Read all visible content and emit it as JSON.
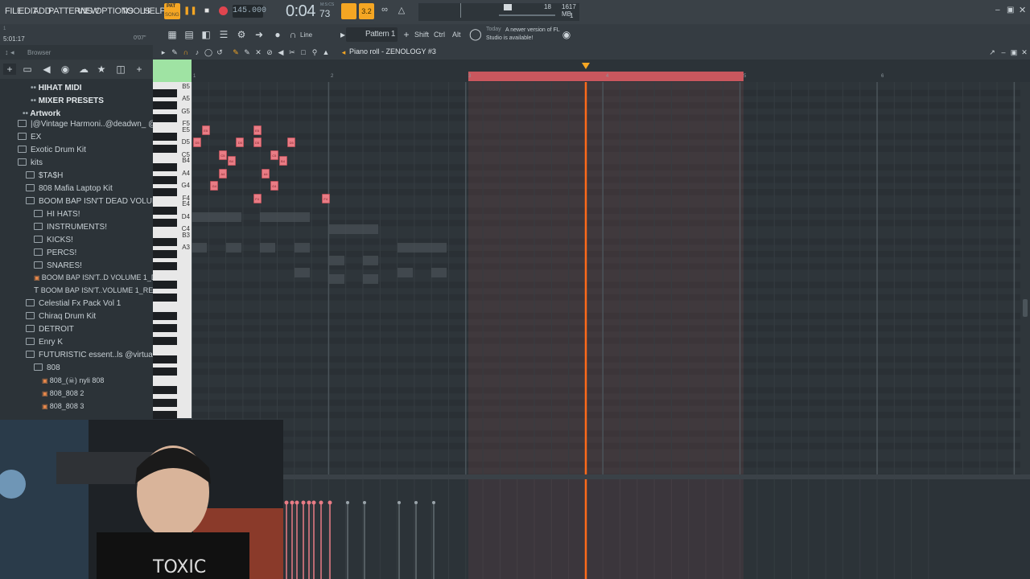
{
  "menu": [
    "FILE",
    "EDIT",
    "ADD",
    "PATTERNS",
    "VIEW",
    "OPTIONS",
    "TOOLS",
    "HELP"
  ],
  "transport": {
    "pat_label": "PAT",
    "song_label": "SONG",
    "tempo": "145.000",
    "time": "0:04",
    "time_small": "73",
    "time_unit": "M:S:CS",
    "cpu": "18",
    "memory": "1617 MB",
    "poly": "1"
  },
  "hint": {
    "time": "5:01:17",
    "value": "0'07\""
  },
  "toolbar": {
    "line_label": "Line",
    "pattern_label": "Pattern 1",
    "shift_label": "Shift",
    "ctrl_label": "Ctrl",
    "alt_label": "Alt",
    "news_day": "Today",
    "news_text": "A newer version of FL Studio is available!"
  },
  "browser": {
    "title": "Browser",
    "items": [
      {
        "label": "HIHAT MIDI",
        "indent": 38,
        "bold": true,
        "kind": "dots"
      },
      {
        "label": "MIXER PRESETS",
        "indent": 38,
        "bold": true,
        "kind": "dots"
      },
      {
        "label": "Artwork",
        "indent": 28,
        "bold": true,
        "kind": "dots"
      },
      {
        "label": "|@Vintage Harmoni..@deadwn_ @1mvnti",
        "indent": 22,
        "kind": "folder"
      },
      {
        "label": "EX",
        "indent": 22,
        "kind": "folder"
      },
      {
        "label": "Exotic Drum Kit",
        "indent": 22,
        "kind": "folder"
      },
      {
        "label": "kits",
        "indent": 22,
        "kind": "folder"
      },
      {
        "label": "$TA$H",
        "indent": 32,
        "kind": "folder"
      },
      {
        "label": "808 Mafia Laptop Kit",
        "indent": 32,
        "kind": "folder"
      },
      {
        "label": "BOOM BAP ISN'T DEAD VOLUME 1",
        "indent": 32,
        "kind": "folder",
        "selected": true
      },
      {
        "label": "HI HATS!",
        "indent": 42,
        "kind": "folder"
      },
      {
        "label": "INSTRUMENTS!",
        "indent": 42,
        "kind": "folder"
      },
      {
        "label": "KICKS!",
        "indent": 42,
        "kind": "folder"
      },
      {
        "label": "PERCS!",
        "indent": 42,
        "kind": "folder"
      },
      {
        "label": "SNARES!",
        "indent": 42,
        "kind": "folder"
      },
      {
        "label": "BOOM BAP ISN'T..D VOLUME 1_DEMO",
        "indent": 42,
        "kind": "file"
      },
      {
        "label": "BOOM BAP ISN'T..VOLUME 1_README",
        "indent": 42,
        "kind": "text"
      },
      {
        "label": "Celestial Fx Pack Vol 1",
        "indent": 32,
        "kind": "folder"
      },
      {
        "label": "Chiraq Drum Kit",
        "indent": 32,
        "kind": "folder"
      },
      {
        "label": "DETROIT",
        "indent": 32,
        "kind": "folder"
      },
      {
        "label": "Enry K",
        "indent": 32,
        "kind": "folder"
      },
      {
        "label": "FUTURISTIC essent..ls @virtualflavor",
        "indent": 32,
        "kind": "folder"
      },
      {
        "label": "808",
        "indent": 42,
        "kind": "folder"
      },
      {
        "label": "808_(☠) nyli 808",
        "indent": 52,
        "kind": "file"
      },
      {
        "label": "808_808 2",
        "indent": 52,
        "kind": "file"
      },
      {
        "label": "808_808 3",
        "indent": 52,
        "kind": "file"
      }
    ]
  },
  "pianoroll": {
    "title": "Piano roll - ZENOLOGY #3",
    "bars": [
      "1",
      "2",
      "3",
      "4",
      "5",
      "6"
    ],
    "keys": [
      "B5",
      "A5",
      "G5",
      "F5",
      "E5",
      "D5",
      "C5",
      "B4",
      "A4",
      "G4",
      "F4",
      "E4",
      "D4",
      "C4",
      "B3",
      "A3"
    ],
    "notes": [
      {
        "label": "E5",
        "key": "E5",
        "beat": 0.5
      },
      {
        "label": "D5",
        "key": "D5",
        "beat": 0
      },
      {
        "label": "C5",
        "key": "C5",
        "beat": 1.5
      },
      {
        "label": "D5",
        "key": "D5",
        "beat": 2.5
      },
      {
        "label": "D5",
        "key": "D5",
        "beat": 3.5
      },
      {
        "label": "E5",
        "key": "E5",
        "beat": 3.5
      },
      {
        "label": "C5",
        "key": "C5",
        "beat": 4.5
      },
      {
        "label": "D5",
        "key": "D5",
        "beat": 5.5
      },
      {
        "label": "B4",
        "key": "B4",
        "beat": 2
      },
      {
        "label": "A4",
        "key": "A4",
        "beat": 1.5
      },
      {
        "label": "A4",
        "key": "A4",
        "beat": 4
      },
      {
        "label": "B4",
        "key": "B4",
        "beat": 5
      },
      {
        "label": "G4",
        "key": "G4",
        "beat": 1
      },
      {
        "label": "G4",
        "key": "G4",
        "beat": 4.5
      },
      {
        "label": "F4",
        "key": "F4",
        "beat": 3.5
      },
      {
        "label": "F4",
        "key": "F4",
        "beat": 7.5
      }
    ]
  },
  "colors": {
    "accent": "#e97c85",
    "playhead": "#ff6a1a",
    "loop": "#c9575e",
    "bg": "#2b3238"
  }
}
